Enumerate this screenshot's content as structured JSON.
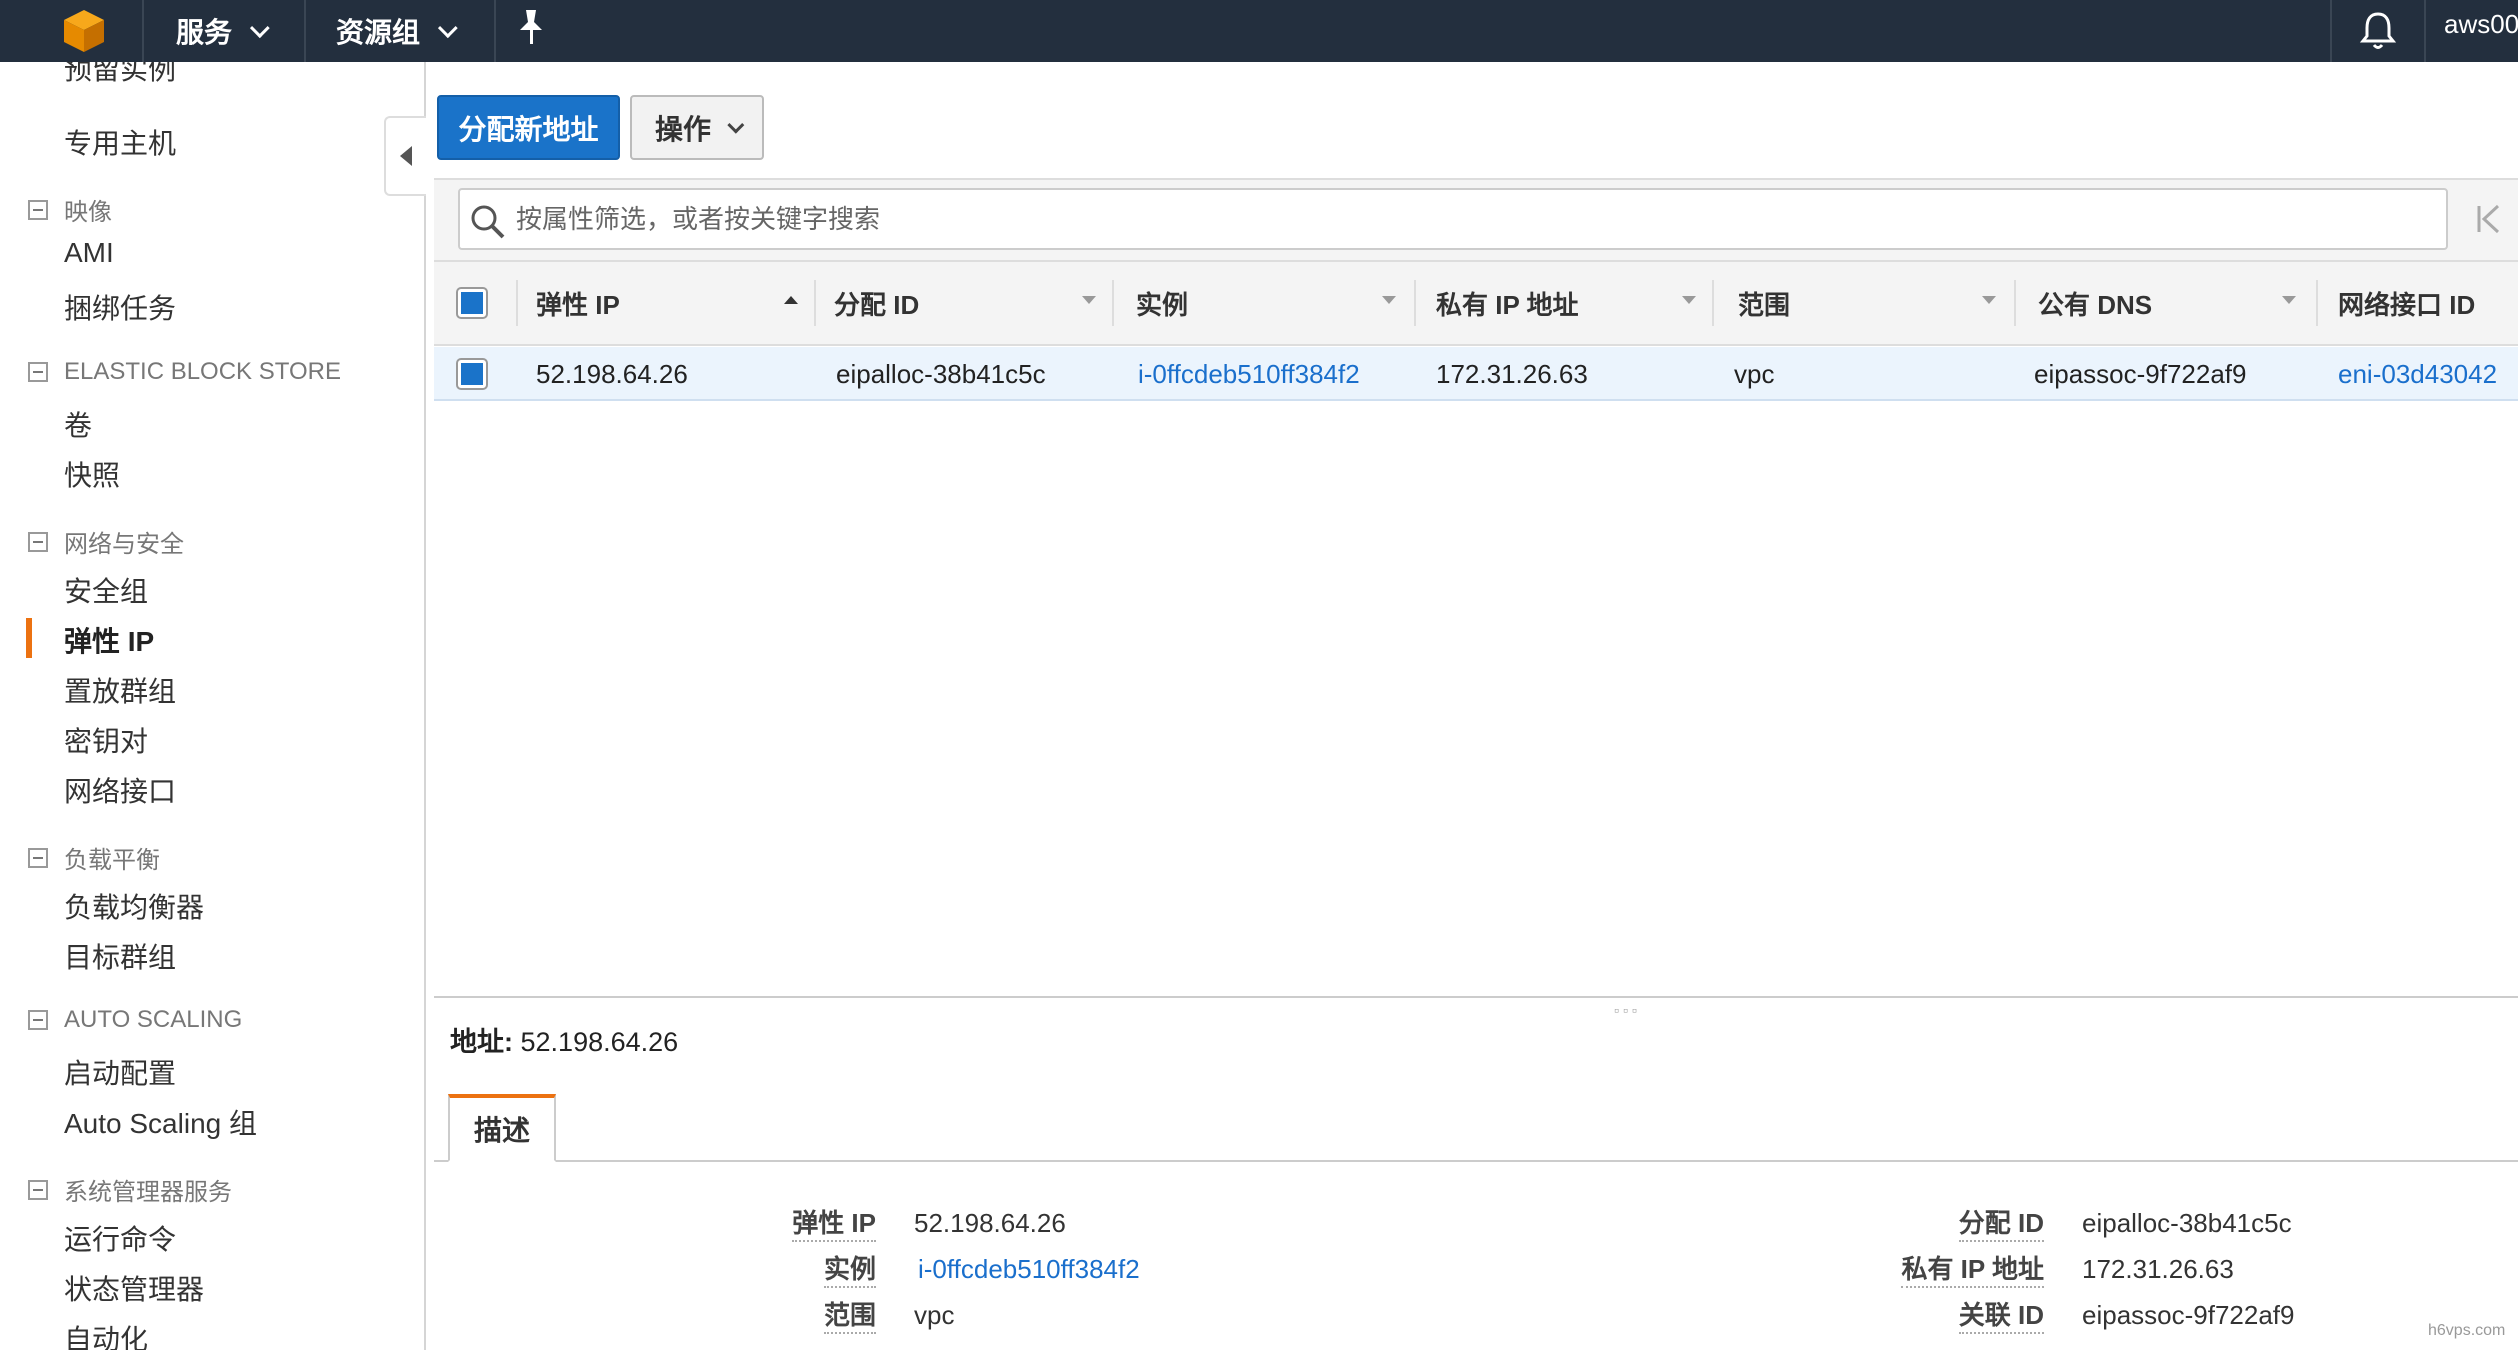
{
  "topbar": {
    "services_label": "服务",
    "resource_groups_label": "资源组",
    "user_label": "aws00"
  },
  "sidebar": {
    "partial_top_item": "预留实例",
    "dedicated_hosts": "专用主机",
    "groups": {
      "images": "映像",
      "ebs": "ELASTIC BLOCK STORE",
      "network": "网络与安全",
      "load_balancing": "负载平衡",
      "auto_scaling": "AUTO SCALING",
      "systems_manager": "系统管理器服务"
    },
    "items": {
      "ami": "AMI",
      "bundle_tasks": "捆绑任务",
      "volumes": "卷",
      "snapshots": "快照",
      "security_groups": "安全组",
      "elastic_ips": "弹性 IP",
      "placement_groups": "置放群组",
      "key_pairs": "密钥对",
      "network_interfaces": "网络接口",
      "load_balancers": "负载均衡器",
      "target_groups": "目标群组",
      "launch_configs": "启动配置",
      "auto_scaling_groups": "Auto Scaling 组",
      "run_command": "运行命令",
      "state_manager": "状态管理器",
      "automation": "自动化"
    }
  },
  "toolbar": {
    "allocate_label": "分配新地址",
    "actions_label": "操作"
  },
  "search": {
    "placeholder": "按属性筛选，或者按关键字搜索"
  },
  "table": {
    "columns": [
      "弹性 IP",
      "分配 ID",
      "实例",
      "私有 IP 地址",
      "范围",
      "公有 DNS",
      "网络接口 ID"
    ],
    "rows": [
      {
        "elastic_ip": "52.198.64.26",
        "allocation_id": "eipalloc-38b41c5c",
        "instance": "i-0ffcdeb510ff384f2",
        "private_ip": "172.31.26.63",
        "scope": "vpc",
        "public_dns": "eipassoc-9f722af9",
        "eni": "eni-03d43042"
      }
    ]
  },
  "detail": {
    "title_label": "地址:",
    "title_value": "52.198.64.26",
    "tab_label": "描述",
    "left": [
      {
        "label": "弹性 IP",
        "value": "52.198.64.26"
      },
      {
        "label": "实例",
        "value": "i-0ffcdeb510ff384f2"
      },
      {
        "label": "范围",
        "value": "vpc"
      }
    ],
    "right": [
      {
        "label": "分配 ID",
        "value": "eipalloc-38b41c5c"
      },
      {
        "label": "私有 IP 地址",
        "value": "172.31.26.63"
      },
      {
        "label": "关联 ID",
        "value": "eipassoc-9f722af9"
      }
    ]
  },
  "watermark": "h6vps.com",
  "colors": {
    "topbar": "#232f3e",
    "primary_button": "#1a73c9",
    "active_accent": "#ec7211",
    "link": "#1a6fcc",
    "selected_row": "#ebf4fd"
  }
}
